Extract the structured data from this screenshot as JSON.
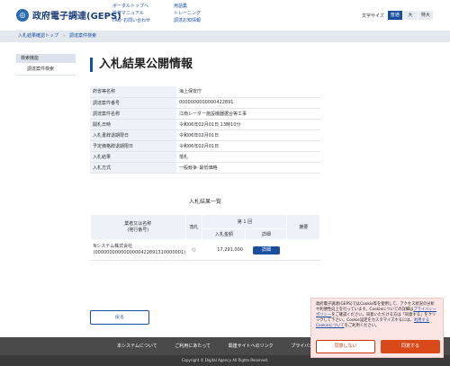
{
  "header": {
    "logo_text": "政府電子調達(GEPS)",
    "links_col1": [
      "ポータルトップへ",
      "操作マニュアル",
      "FAQ･お問い合わせ"
    ],
    "links_col2": [
      "用語集",
      "トレーニング",
      "調達お知情報"
    ],
    "font_size_label": "文字サイズ",
    "font_sizes": [
      "普通",
      "大",
      "特大"
    ],
    "font_size_selected": "普通"
  },
  "breadcrumb": [
    "入札結果確認トップ",
    "調達案件検索"
  ],
  "sidebar": {
    "heading": "検索機能",
    "items": [
      "調達案件検索"
    ]
  },
  "main": {
    "title": "入札結果公開情報",
    "info_rows": [
      {
        "label": "府省等名称",
        "value": "海上保安庁"
      },
      {
        "label": "調達案件番号",
        "value": "0000000000000422891"
      },
      {
        "label": "調達案件名称",
        "value": "江南レーダー施設機器据合等工事"
      },
      {
        "label": "開札日時",
        "value": "令和06年02月01日 13時10分"
      },
      {
        "label": "入札書辞退期限日",
        "value": "令和06年02月01日"
      },
      {
        "label": "予定価格辞退期限日",
        "value": "令和06年02月01日"
      },
      {
        "label": "入札結果",
        "value": "落札"
      },
      {
        "label": "入札方式",
        "value": "一般競争･最低価格"
      }
    ],
    "result_title": "入札結果一覧",
    "result_headers": {
      "company": "業者又は名称\n(発行番号)",
      "awarded": "落札",
      "round": "第 1 回",
      "amount": "入札金額",
      "detail": "詳細",
      "remarks": "摘要"
    },
    "result_rows": [
      {
        "company": "Nシステム株式会社",
        "company_id": "(0000000000000000422891310000001)",
        "awarded": "○",
        "amount": "17,291,000",
        "detail_label": "詳細",
        "remarks": ""
      }
    ],
    "back_label": "戻る"
  },
  "footer": {
    "links": [
      "本システムについて",
      "ご利用にあたって",
      "関連サイトへのリンク",
      "プライバシーポリシー"
    ],
    "copyright": "Copyright © Digital Agency All Rights Reserved."
  },
  "cookie": {
    "text_before": "政府電子調達(GEPS)ではCookie等を使用して、アクセス状況の分析や利便性向上を行っています。Cookieについての詳細は",
    "privacy_link": "プライバシーポリシー",
    "text_middle": "をご確認ください。同意いただける方は「同意する」をクリックして下さい。Cookie設定をカスタマイズするには、",
    "settings_link": "利用するCookieについて",
    "text_after": "をご利用ください。",
    "deny_label": "同意しない",
    "agree_label": "同意する"
  }
}
